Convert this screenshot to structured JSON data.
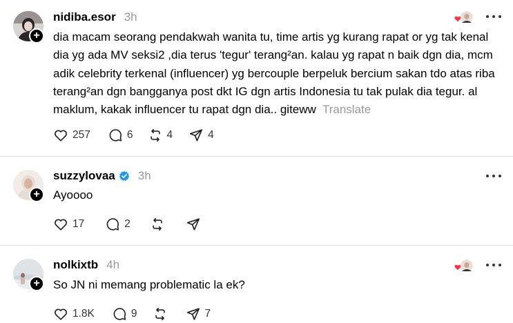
{
  "posts": [
    {
      "username": "nidiba.esor",
      "time": "3h",
      "verified": false,
      "text": "dia macam seorang pendakwah wanita tu, time artis yg kurang rapat or yg tak kenal dia yg ada MV seksi2 ,dia terus 'tegur' terang²an. kalau yg rapat n baik dgn dia, mcm adik celebrity terkenal (influencer) yg bercouple berpeluk bercium sakan tdo atas riba terang²an dgn bangganya post dkt IG dgn artis Indonesia tu tak pulak dia tegur. al maklum, kakak influencer tu rapat dgn dia.. giteww",
      "translate_label": "Translate",
      "likes": "257",
      "replies": "6",
      "reposts": "4",
      "shares": "4"
    },
    {
      "username": "suzzylovaa",
      "time": "3h",
      "verified": true,
      "text": "Ayoooo",
      "likes": "17",
      "replies": "2",
      "reposts": "",
      "shares": ""
    },
    {
      "username": "nolkixtb",
      "time": "4h",
      "verified": false,
      "text": "So JN ni memang problematic la ek?",
      "likes": "1.8K",
      "replies": "9",
      "reposts": "",
      "shares": "7"
    }
  ],
  "icons": {
    "like": "heart-icon",
    "reply": "comment-icon",
    "repost": "repost-icon",
    "share": "send-icon",
    "more": "more-icon",
    "verified": "verified-badge-icon",
    "follow": "plus-icon"
  },
  "colors": {
    "verified": "#1d9bf0",
    "liked_heart": "#ff3040",
    "muted_text": "#999999",
    "divider": "#dddddd"
  }
}
